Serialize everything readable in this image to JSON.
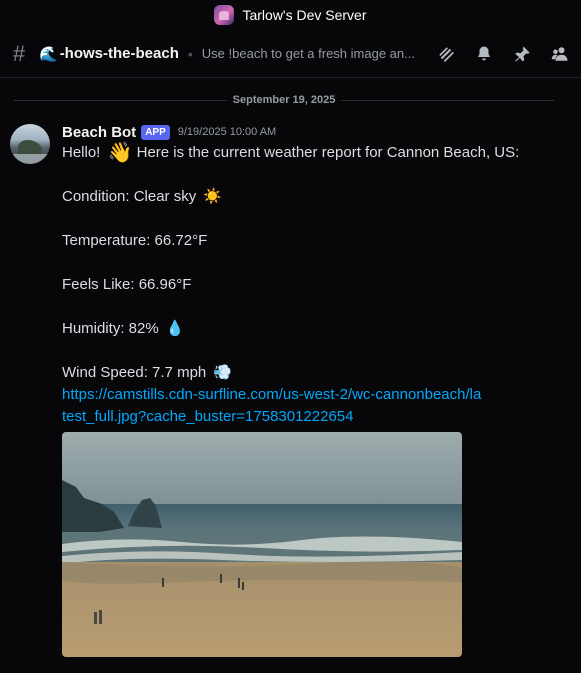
{
  "titlebar": {
    "server_name": "Tarlow's Dev Server"
  },
  "channel": {
    "name": "-hows-the-beach",
    "emoji": "🌊",
    "topic": "Use !beach to get a fresh image an..."
  },
  "header_icons": [
    "threads-icon",
    "bell-icon",
    "pin-icon",
    "members-icon"
  ],
  "date_divider": "September 19, 2025",
  "message": {
    "author": "Beach Bot",
    "badge": "APP",
    "timestamp": "9/19/2025 10:00 AM",
    "lines": {
      "greeting": "Hello! ",
      "greeting_rest": " Here is the current weather report for Cannon Beach, US:",
      "condition": "Condition: Clear sky ",
      "temperature": "Temperature: 66.72°F",
      "feels_like": "Feels Like: 66.96°F",
      "humidity": "Humidity: 82% ",
      "wind": "Wind Speed: 7.7 mph "
    },
    "emojis": {
      "wave": "👋",
      "sun": "☀️",
      "droplet": "💧",
      "wind": "💨"
    },
    "link": "https://camstills.cdn-surfline.com/us-west-2/wc-cannonbeach/latest_full.jpg?cache_buster=1758301222654"
  },
  "colors": {
    "background": "#070709",
    "link": "#00a8fc",
    "badge": "#5865f2"
  }
}
